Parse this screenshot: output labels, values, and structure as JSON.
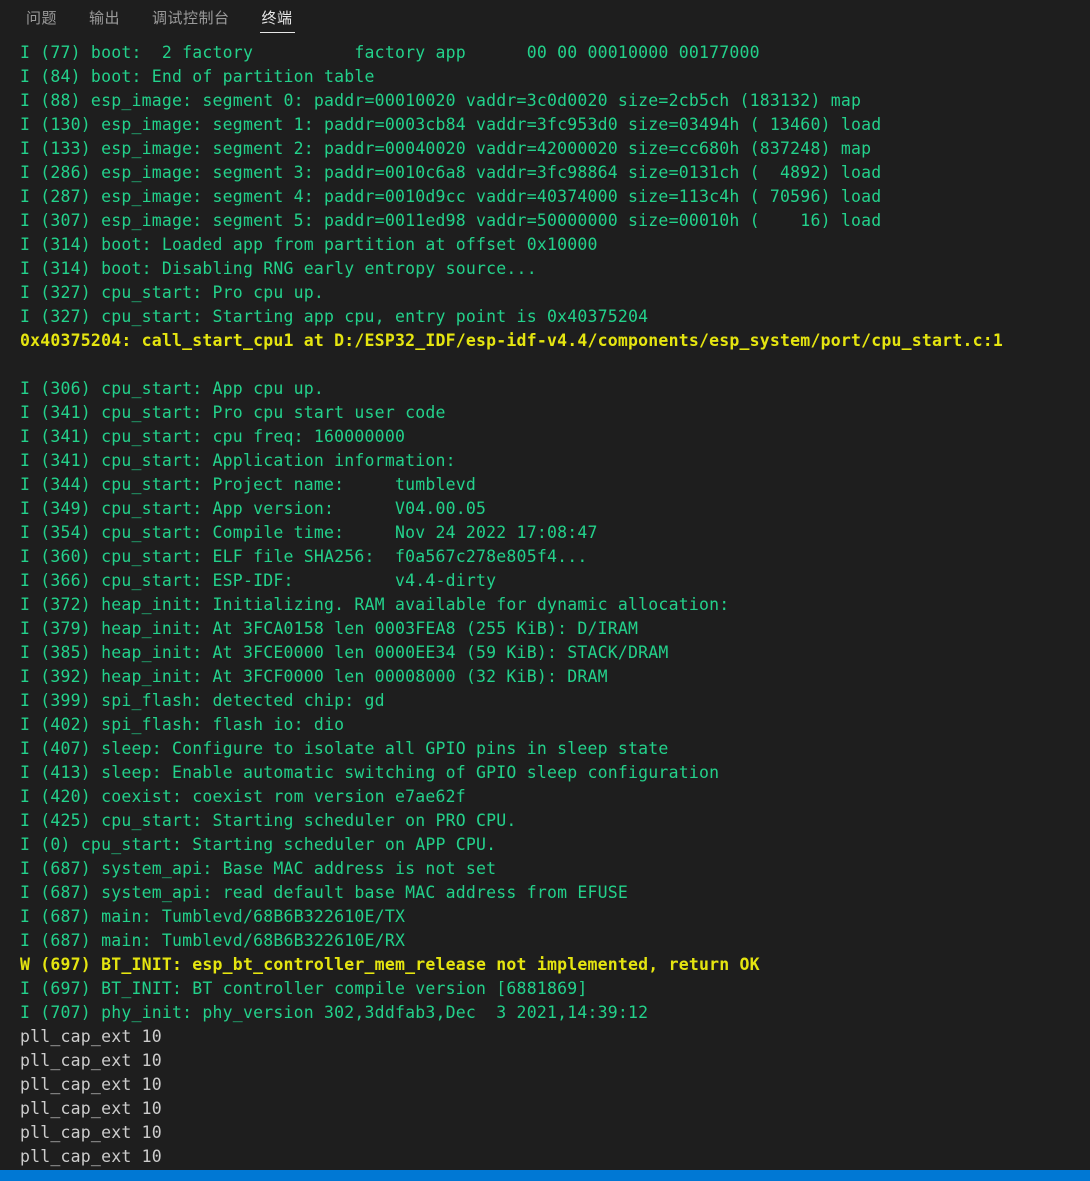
{
  "panel": {
    "tabs": [
      {
        "label": "问题",
        "name": "tab-problems",
        "active": false
      },
      {
        "label": "输出",
        "name": "tab-output",
        "active": false
      },
      {
        "label": "调试控制台",
        "name": "tab-debug-console",
        "active": false
      },
      {
        "label": "终端",
        "name": "tab-terminal",
        "active": true
      }
    ]
  },
  "colors": {
    "background": "#1e1e1e",
    "info_green": "#23d18b",
    "warn_yellow": "#e5e510",
    "default_fg": "#cccccc",
    "statusbar_blue": "#0078d4",
    "tab_active_fg": "#e7e7e7",
    "tab_inactive_fg": "#9a9a9a"
  },
  "terminal": {
    "lines": [
      {
        "color": "green",
        "text": "I (77) boot:  2 factory          factory app      00 00 00010000 00177000"
      },
      {
        "color": "green",
        "text": "I (84) boot: End of partition table"
      },
      {
        "color": "green",
        "text": "I (88) esp_image: segment 0: paddr=00010020 vaddr=3c0d0020 size=2cb5ch (183132) map"
      },
      {
        "color": "green",
        "text": "I (130) esp_image: segment 1: paddr=0003cb84 vaddr=3fc953d0 size=03494h ( 13460) load"
      },
      {
        "color": "green",
        "text": "I (133) esp_image: segment 2: paddr=00040020 vaddr=42000020 size=cc680h (837248) map"
      },
      {
        "color": "green",
        "text": "I (286) esp_image: segment 3: paddr=0010c6a8 vaddr=3fc98864 size=0131ch (  4892) load"
      },
      {
        "color": "green",
        "text": "I (287) esp_image: segment 4: paddr=0010d9cc vaddr=40374000 size=113c4h ( 70596) load"
      },
      {
        "color": "green",
        "text": "I (307) esp_image: segment 5: paddr=0011ed98 vaddr=50000000 size=00010h (    16) load"
      },
      {
        "color": "green",
        "text": "I (314) boot: Loaded app from partition at offset 0x10000"
      },
      {
        "color": "green",
        "text": "I (314) boot: Disabling RNG early entropy source..."
      },
      {
        "color": "green",
        "text": "I (327) cpu_start: Pro cpu up."
      },
      {
        "color": "green",
        "text": "I (327) cpu_start: Starting app cpu, entry point is 0x40375204"
      },
      {
        "color": "yellow",
        "text": "0x40375204: call_start_cpu1 at D:/ESP32_IDF/esp-idf-v4.4/components/esp_system/port/cpu_start.c:1"
      },
      {
        "color": "blank",
        "text": ""
      },
      {
        "color": "green",
        "text": "I (306) cpu_start: App cpu up."
      },
      {
        "color": "green",
        "text": "I (341) cpu_start: Pro cpu start user code"
      },
      {
        "color": "green",
        "text": "I (341) cpu_start: cpu freq: 160000000"
      },
      {
        "color": "green",
        "text": "I (341) cpu_start: Application information:"
      },
      {
        "color": "green",
        "text": "I (344) cpu_start: Project name:     tumblevd"
      },
      {
        "color": "green",
        "text": "I (349) cpu_start: App version:      V04.00.05"
      },
      {
        "color": "green",
        "text": "I (354) cpu_start: Compile time:     Nov 24 2022 17:08:47"
      },
      {
        "color": "green",
        "text": "I (360) cpu_start: ELF file SHA256:  f0a567c278e805f4..."
      },
      {
        "color": "green",
        "text": "I (366) cpu_start: ESP-IDF:          v4.4-dirty"
      },
      {
        "color": "green",
        "text": "I (372) heap_init: Initializing. RAM available for dynamic allocation:"
      },
      {
        "color": "green",
        "text": "I (379) heap_init: At 3FCA0158 len 0003FEA8 (255 KiB): D/IRAM"
      },
      {
        "color": "green",
        "text": "I (385) heap_init: At 3FCE0000 len 0000EE34 (59 KiB): STACK/DRAM"
      },
      {
        "color": "green",
        "text": "I (392) heap_init: At 3FCF0000 len 00008000 (32 KiB): DRAM"
      },
      {
        "color": "green",
        "text": "I (399) spi_flash: detected chip: gd"
      },
      {
        "color": "green",
        "text": "I (402) spi_flash: flash io: dio"
      },
      {
        "color": "green",
        "text": "I (407) sleep: Configure to isolate all GPIO pins in sleep state"
      },
      {
        "color": "green",
        "text": "I (413) sleep: Enable automatic switching of GPIO sleep configuration"
      },
      {
        "color": "green",
        "text": "I (420) coexist: coexist rom version e7ae62f"
      },
      {
        "color": "green",
        "text": "I (425) cpu_start: Starting scheduler on PRO CPU."
      },
      {
        "color": "green",
        "text": "I (0) cpu_start: Starting scheduler on APP CPU."
      },
      {
        "color": "green",
        "text": "I (687) system_api: Base MAC address is not set"
      },
      {
        "color": "green",
        "text": "I (687) system_api: read default base MAC address from EFUSE"
      },
      {
        "color": "green",
        "text": "I (687) main: Tumblevd/68B6B322610E/TX"
      },
      {
        "color": "green",
        "text": "I (687) main: Tumblevd/68B6B322610E/RX"
      },
      {
        "color": "yellow",
        "text": "W (697) BT_INIT: esp_bt_controller_mem_release not implemented, return OK"
      },
      {
        "color": "green",
        "text": "I (697) BT_INIT: BT controller compile version [6881869]"
      },
      {
        "color": "green",
        "text": "I (707) phy_init: phy_version 302,3ddfab3,Dec  3 2021,14:39:12"
      },
      {
        "color": "white",
        "text": "pll_cap_ext 10"
      },
      {
        "color": "white",
        "text": "pll_cap_ext 10"
      },
      {
        "color": "white",
        "text": "pll_cap_ext 10"
      },
      {
        "color": "white",
        "text": "pll_cap_ext 10"
      },
      {
        "color": "white",
        "text": "pll_cap_ext 10"
      },
      {
        "color": "white",
        "text": "pll_cap_ext 10"
      }
    ]
  }
}
